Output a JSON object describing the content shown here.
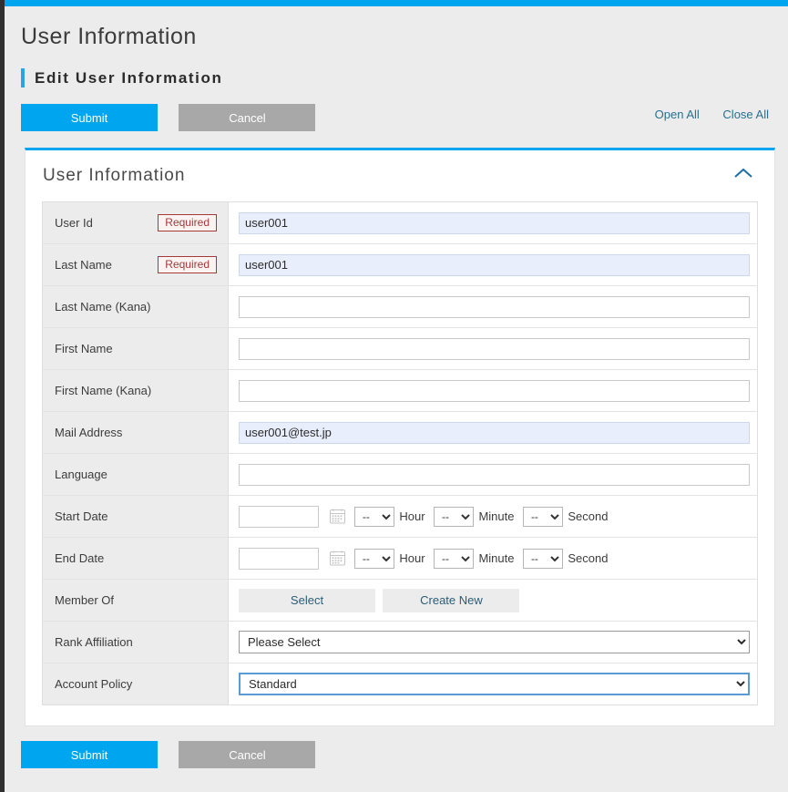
{
  "header": {
    "page_title": "User Information",
    "subtitle": "Edit User Information"
  },
  "toolbar": {
    "submit_label": "Submit",
    "cancel_label": "Cancel",
    "open_all_label": "Open All",
    "close_all_label": "Close All"
  },
  "card": {
    "title": "User Information",
    "collapse_icon": "chevron-up-icon"
  },
  "fields": {
    "user_id": {
      "label": "User Id",
      "required_badge": "Required",
      "value": "user001"
    },
    "last_name": {
      "label": "Last Name",
      "required_badge": "Required",
      "value": "user001"
    },
    "last_name_kana": {
      "label": "Last Name (Kana)",
      "value": ""
    },
    "first_name": {
      "label": "First Name",
      "value": ""
    },
    "first_name_kana": {
      "label": "First Name (Kana)",
      "value": ""
    },
    "mail_address": {
      "label": "Mail Address",
      "value": "user001@test.jp"
    },
    "language": {
      "label": "Language",
      "value": ""
    },
    "start_date": {
      "label": "Start Date",
      "value": "",
      "calendar_icon": "calendar-icon",
      "hour_value": "--",
      "hour_unit": "Hour",
      "minute_value": "--",
      "minute_unit": "Minute",
      "second_value": "--",
      "second_unit": "Second"
    },
    "end_date": {
      "label": "End Date",
      "value": "",
      "calendar_icon": "calendar-icon",
      "hour_value": "--",
      "hour_unit": "Hour",
      "minute_value": "--",
      "minute_unit": "Minute",
      "second_value": "--",
      "second_unit": "Second"
    },
    "member_of": {
      "label": "Member Of",
      "select_label": "Select",
      "create_new_label": "Create New"
    },
    "rank_affiliation": {
      "label": "Rank Affiliation",
      "value": "Please Select"
    },
    "account_policy": {
      "label": "Account Policy",
      "value": "Standard"
    }
  },
  "footer": {
    "submit_label": "Submit",
    "cancel_label": "Cancel"
  },
  "colors": {
    "accent_blue": "#00a5ef",
    "secondary_gray": "#a8a8a8",
    "required_red": "#a33a3a",
    "link_blue": "#2a6f8e",
    "filled_input_bg": "#e8eefb"
  }
}
